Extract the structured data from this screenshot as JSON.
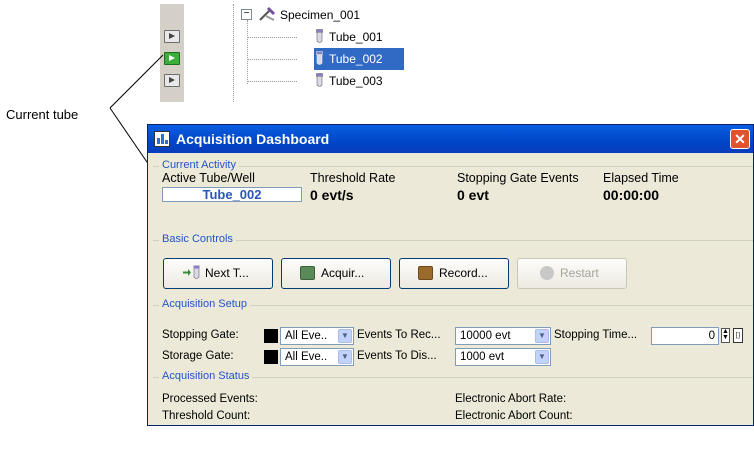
{
  "tree": {
    "specimen": "Specimen_001",
    "tubes": [
      "Tube_001",
      "Tube_002",
      "Tube_003"
    ],
    "selected_index": 1
  },
  "callout": {
    "label": "Current tube"
  },
  "window": {
    "title": "Acquisition Dashboard",
    "close_glyph": "✕"
  },
  "current_activity": {
    "title": "Current Activity",
    "active_tube_label": "Active Tube/Well",
    "active_tube_value": "Tube_002",
    "threshold_rate_label": "Threshold Rate",
    "threshold_rate_value": "0 evt/s",
    "stopping_gate_events_label": "Stopping Gate Events",
    "stopping_gate_events_value": "0 evt",
    "elapsed_time_label": "Elapsed Time",
    "elapsed_time_value": "00:00:00"
  },
  "basic_controls": {
    "title": "Basic Controls",
    "next_tube": "Next T...",
    "acquire": "Acquir...",
    "record": "Record...",
    "restart": "Restart"
  },
  "acquisition_setup": {
    "title": "Acquisition Setup",
    "stopping_gate_label": "Stopping Gate:",
    "stopping_gate_value": "All Eve..",
    "events_to_record_label": "Events To Rec...",
    "events_to_record_value": "10000 evt",
    "stopping_time_label": "Stopping Time...",
    "stopping_time_value": "0",
    "storage_gate_label": "Storage Gate:",
    "storage_gate_value": "All Eve..",
    "events_to_display_label": "Events To Dis...",
    "events_to_display_value": "1000 evt"
  },
  "acquisition_status": {
    "title": "Acquisition Status",
    "processed_events": "Processed Events:",
    "threshold_count": "Threshold Count:",
    "electronic_abort_rate": "Electronic Abort Rate:",
    "electronic_abort_count": "Electronic Abort Count:"
  },
  "colors": {
    "selection": "#316ac5",
    "title_bar": "#0046c8",
    "group_title": "#2154c9",
    "acquire_icon": "#5a8a5a",
    "record_icon": "#9a6a2a"
  }
}
